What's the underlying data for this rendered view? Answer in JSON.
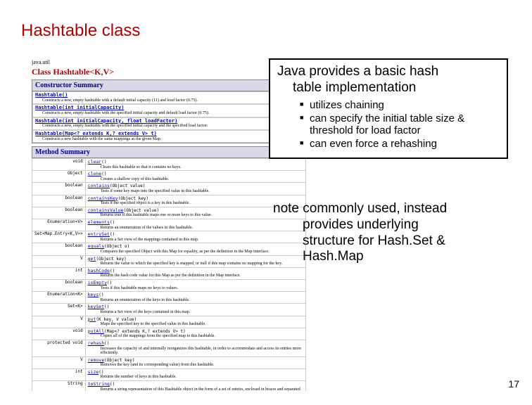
{
  "title": "Hashtable class",
  "javadoc": {
    "package": "java.util",
    "class_heading": "Class Hashtable<K,V>",
    "constructor_header": "Constructor Summary",
    "constructors": [
      {
        "sig": "Hashtable()",
        "desc": "Constructs a new, empty hashtable with a default initial capacity (11) and load factor (0.75)."
      },
      {
        "sig": "Hashtable(int initialCapacity)",
        "desc": "Constructs a new, empty hashtable with the specified initial capacity and default load factor (0.75)."
      },
      {
        "sig": "Hashtable(int initialCapacity, float loadFactor)",
        "desc": "Constructs a new, empty hashtable with the specified initial capacity and the specified load factor."
      },
      {
        "sig": "Hashtable(Map<? extends K,? extends V> t)",
        "desc": "Constructs a new hashtable with the same mappings as the given Map."
      }
    ],
    "method_header": "Method Summary",
    "methods": [
      {
        "ret": "void",
        "name": "clear",
        "params": "()",
        "desc": "Clears this hashtable so that it contains no keys."
      },
      {
        "ret": "Object",
        "name": "clone",
        "params": "()",
        "desc": "Creates a shallow copy of this hashtable."
      },
      {
        "ret": "boolean",
        "name": "contains",
        "params": "(Object value)",
        "desc": "Tests if some key maps into the specified value in this hashtable."
      },
      {
        "ret": "boolean",
        "name": "containsKey",
        "params": "(Object key)",
        "desc": "Tests if the specified object is a key in this hashtable."
      },
      {
        "ret": "boolean",
        "name": "containsValue",
        "params": "(Object value)",
        "desc": "Returns true if this hashtable maps one or more keys to this value."
      },
      {
        "ret": "Enumeration<V>",
        "name": "elements",
        "params": "()",
        "desc": "Returns an enumeration of the values in this hashtable."
      },
      {
        "ret": "Set<Map.Entry<K,V>>",
        "name": "entrySet",
        "params": "()",
        "desc": "Returns a Set view of the mappings contained in this map."
      },
      {
        "ret": "boolean",
        "name": "equals",
        "params": "(Object o)",
        "desc": "Compares the specified Object with this Map for equality, as per the definition in the Map interface."
      },
      {
        "ret": "V",
        "name": "get",
        "params": "(Object key)",
        "desc": "Returns the value to which the specified key is mapped, or null if this map contains no mapping for the key."
      },
      {
        "ret": "int",
        "name": "hashCode",
        "params": "()",
        "desc": "Returns the hash code value for this Map as per the definition in the Map interface."
      },
      {
        "ret": "boolean",
        "name": "isEmpty",
        "params": "()",
        "desc": "Tests if this hashtable maps no keys to values."
      },
      {
        "ret": "Enumeration<K>",
        "name": "keys",
        "params": "()",
        "desc": "Returns an enumeration of the keys in this hashtable."
      },
      {
        "ret": "Set<K>",
        "name": "keySet",
        "params": "()",
        "desc": "Returns a Set view of the keys contained in this map."
      },
      {
        "ret": "V",
        "name": "put",
        "params": "(K key, V value)",
        "desc": "Maps the specified key to the specified value in this hashtable."
      },
      {
        "ret": "void",
        "name": "putAll",
        "params": "(Map<? extends K,? extends V> t)",
        "desc": "Copies all of the mappings from the specified map to this hashtable."
      },
      {
        "ret": "protected void",
        "name": "rehash",
        "params": "()",
        "desc": "Increases the capacity of and internally reorganizes this hashtable, in order to accommodate and access its entries more efficiently."
      },
      {
        "ret": "V",
        "name": "remove",
        "params": "(Object key)",
        "desc": "Removes the key (and its corresponding value) from this hashtable."
      },
      {
        "ret": "int",
        "name": "size",
        "params": "()",
        "desc": "Returns the number of keys in this hashtable."
      },
      {
        "ret": "String",
        "name": "toString",
        "params": "()",
        "desc": "Returns a string representation of this Hashtable object in the form of a set of entries, enclosed in braces and separated by the ASCII characters \", \" (comma and space)."
      }
    ]
  },
  "textbox": {
    "heading_line1": "Java provides a basic hash",
    "heading_line2": "table implementation",
    "bullets": [
      "utilizes chaining",
      "can specify the initial table size & threshold for load factor",
      "can even force a rehashing"
    ]
  },
  "note": {
    "line1": "note commonly used, instead",
    "line2": "provides underlying",
    "line3": "structure for Hash.Set &",
    "line4": "Hash.Map"
  },
  "page_number": "17"
}
